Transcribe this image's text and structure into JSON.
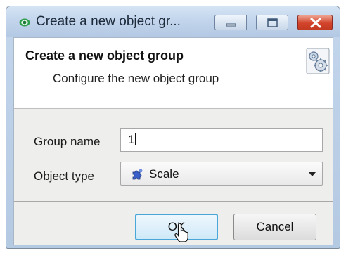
{
  "window": {
    "title": "Create a new object gr..."
  },
  "header": {
    "title": "Create a new object group",
    "subtitle": "Configure the new object group",
    "icon": "settings-gears-icon"
  },
  "form": {
    "group_name": {
      "label": "Group name",
      "value": "1"
    },
    "object_type": {
      "label": "Object type",
      "selected": "Scale",
      "icon": "scale-puzzle-icon"
    }
  },
  "buttons": {
    "ok": "OK",
    "cancel": "Cancel"
  },
  "colors": {
    "title_bar": "#c2d5ec",
    "close_button": "#d2442b",
    "ok_focus_border": "#48a7d8",
    "app_icon": "#2e9e4c"
  }
}
